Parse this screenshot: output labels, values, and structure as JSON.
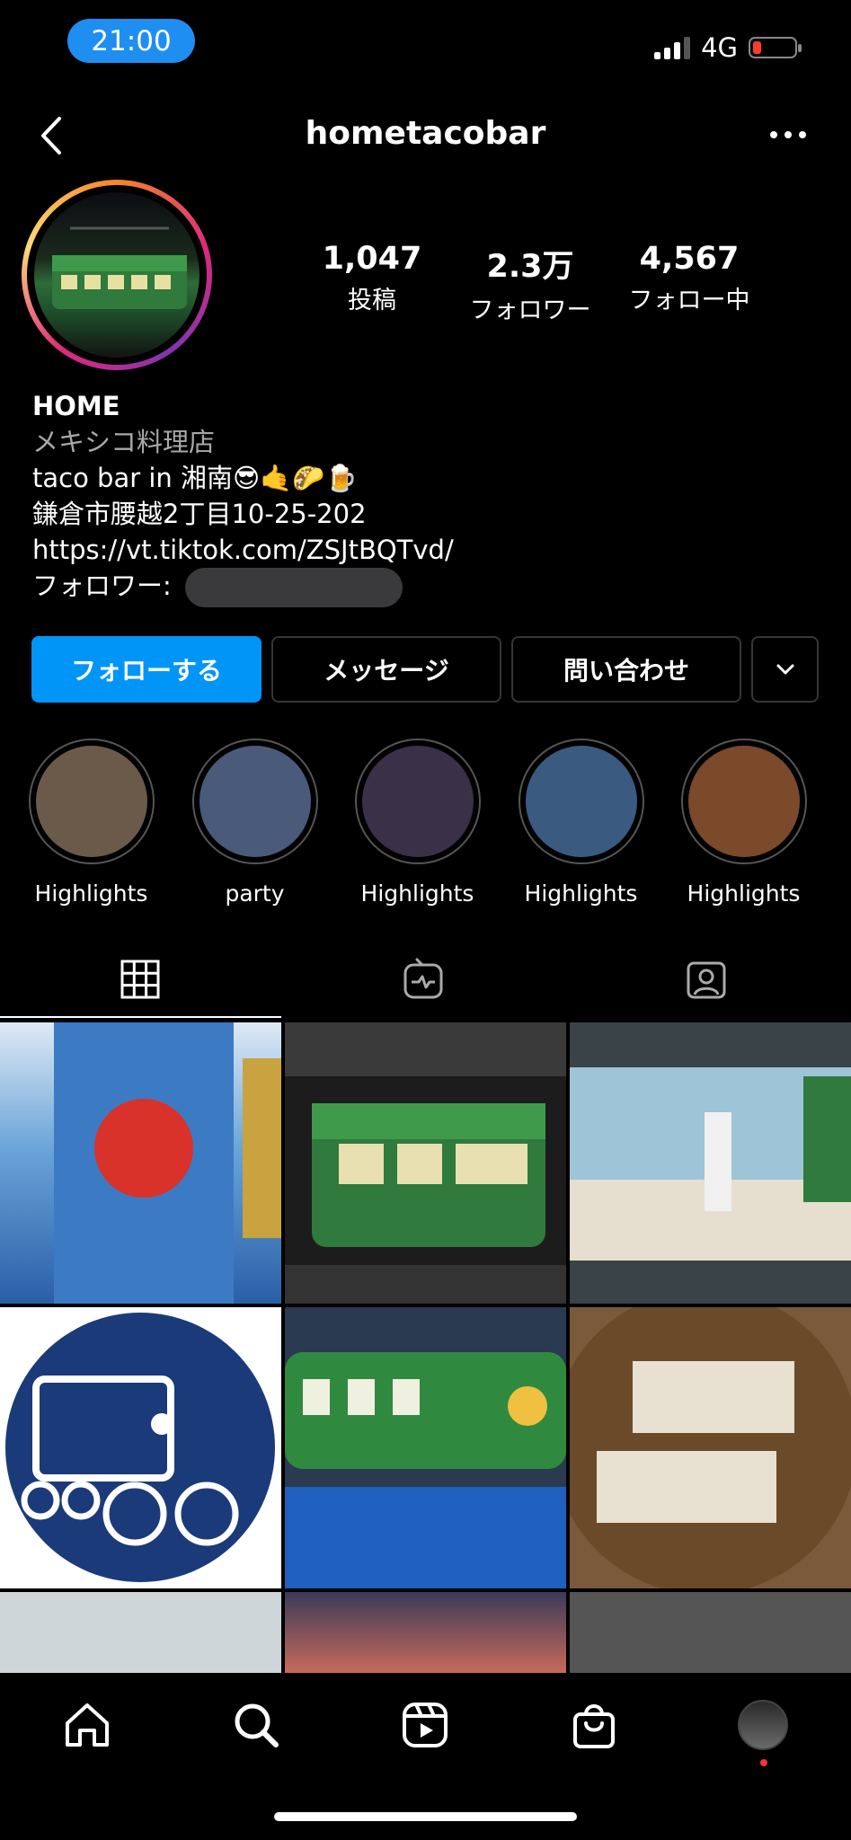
{
  "status": {
    "time": "21:00",
    "network": "4G"
  },
  "header": {
    "username": "hometacobar"
  },
  "stats": [
    {
      "value": "1,047",
      "label": "投稿"
    },
    {
      "value": "2.3万",
      "label": "フォロワー"
    },
    {
      "value": "4,567",
      "label": "フォロー中"
    }
  ],
  "bio": {
    "name": "HOME",
    "category": "メキシコ料理店",
    "line1": "taco bar in 湘南😎🤙🌮🍺",
    "address": "鎌倉市腰越2丁目10-25-202",
    "link": "https://vt.tiktok.com/ZSJtBQTvd/",
    "followers_prefix": "フォロワー: "
  },
  "buttons": {
    "follow": "フォローする",
    "message": "メッセージ",
    "contact": "問い合わせ"
  },
  "highlights": [
    {
      "label": "Highlights",
      "color": "#6b5a4a"
    },
    {
      "label": "party",
      "color": "#4a5a7a"
    },
    {
      "label": "Highlights",
      "color": "#3a3048"
    },
    {
      "label": "Highlights",
      "color": "#3a5a80"
    },
    {
      "label": "Highlights",
      "color": "#7a4a2a"
    }
  ],
  "icons": {
    "tabs": [
      "grid-icon",
      "reels-tv-icon",
      "tagged-person-icon"
    ],
    "nav": [
      "home-icon",
      "search-icon",
      "reels-icon",
      "shop-icon",
      "profile-avatar-icon"
    ]
  },
  "colors": {
    "primary_button": "#0095f6",
    "status_pill": "#1f8ef1",
    "battery_low": "#ff3b30",
    "notification_dot": "#ff3040"
  }
}
